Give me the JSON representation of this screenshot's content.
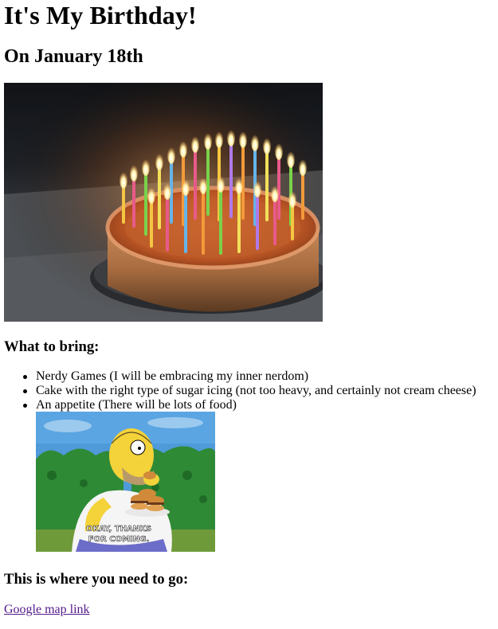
{
  "page": {
    "title": "It's My Birthday!",
    "subtitle": "On January 18th"
  },
  "cake_image": {
    "icon": "birthday-cake-with-candles-photo"
  },
  "bring_section": {
    "heading": "What to bring:",
    "items": [
      {
        "label": "Nerdy Games (I will be embracing my inner nerdom)"
      },
      {
        "label": "Cake with the right type of sugar icing (not too heavy, and certainly not cream cheese)"
      },
      {
        "label": "An appetite (There will be lots of food)"
      }
    ]
  },
  "homer_image": {
    "icon": "homer-with-burgers-gif",
    "caption_line1": "OKAY, THANKS",
    "caption_line2": "FOR COMING."
  },
  "go_section": {
    "heading": "This is where you need to go:",
    "link_label": "Google map link"
  },
  "colors": {
    "visited_link": "#551a8b"
  }
}
